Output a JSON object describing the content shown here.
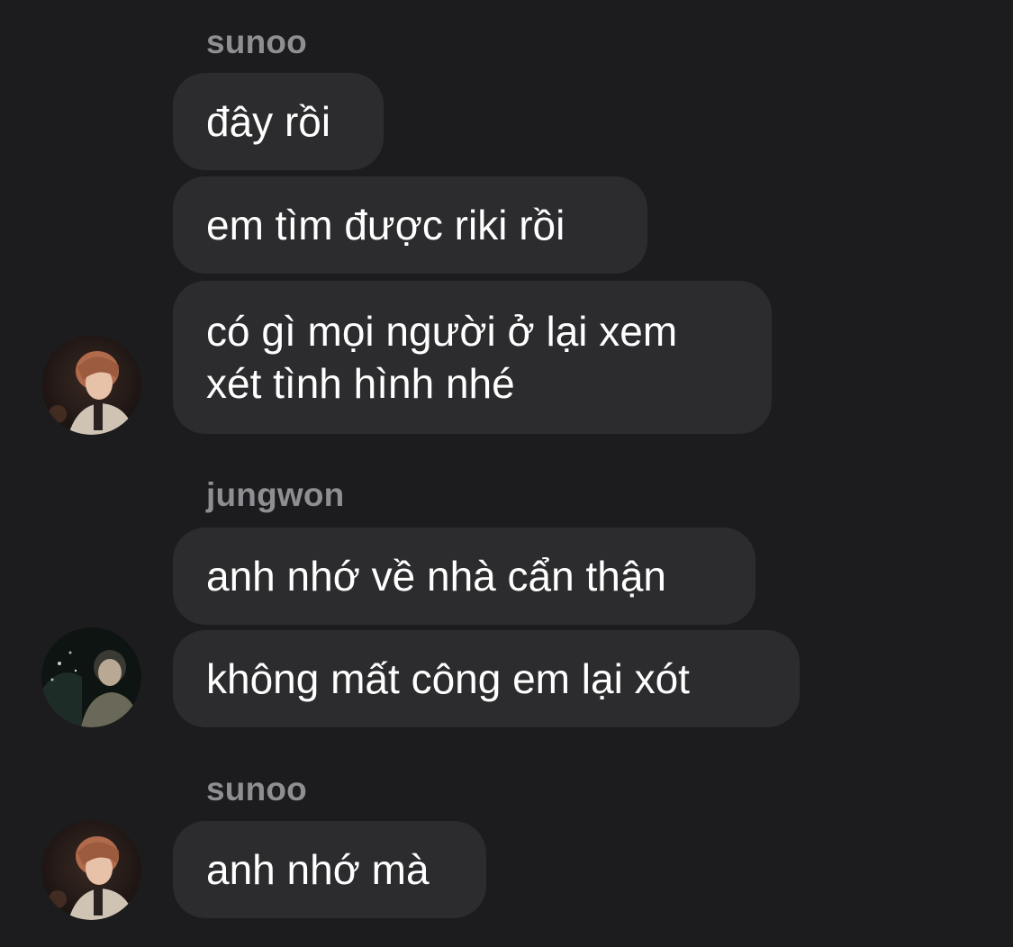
{
  "thread": {
    "groups": [
      {
        "sender": "sunoo",
        "messages": [
          "đây rồi",
          "em tìm được riki rồi",
          [
            "có gì mọi người ở lại xem",
            "xét tình hình nhé"
          ]
        ]
      },
      {
        "sender": "jungwon",
        "messages": [
          "anh nhớ về nhà cẩn thận",
          "không mất công em lại xót"
        ]
      },
      {
        "sender": "sunoo",
        "messages": [
          "anh nhớ mà"
        ]
      }
    ]
  },
  "colors": {
    "background": "#1c1c1e",
    "bubble": "#2c2c2e",
    "sender_name": "#8e8e93",
    "message_text": "#ffffff"
  },
  "icons": {
    "sunoo_avatar": "avatar-photo-sunoo",
    "jungwon_avatar": "avatar-photo-jungwon"
  }
}
